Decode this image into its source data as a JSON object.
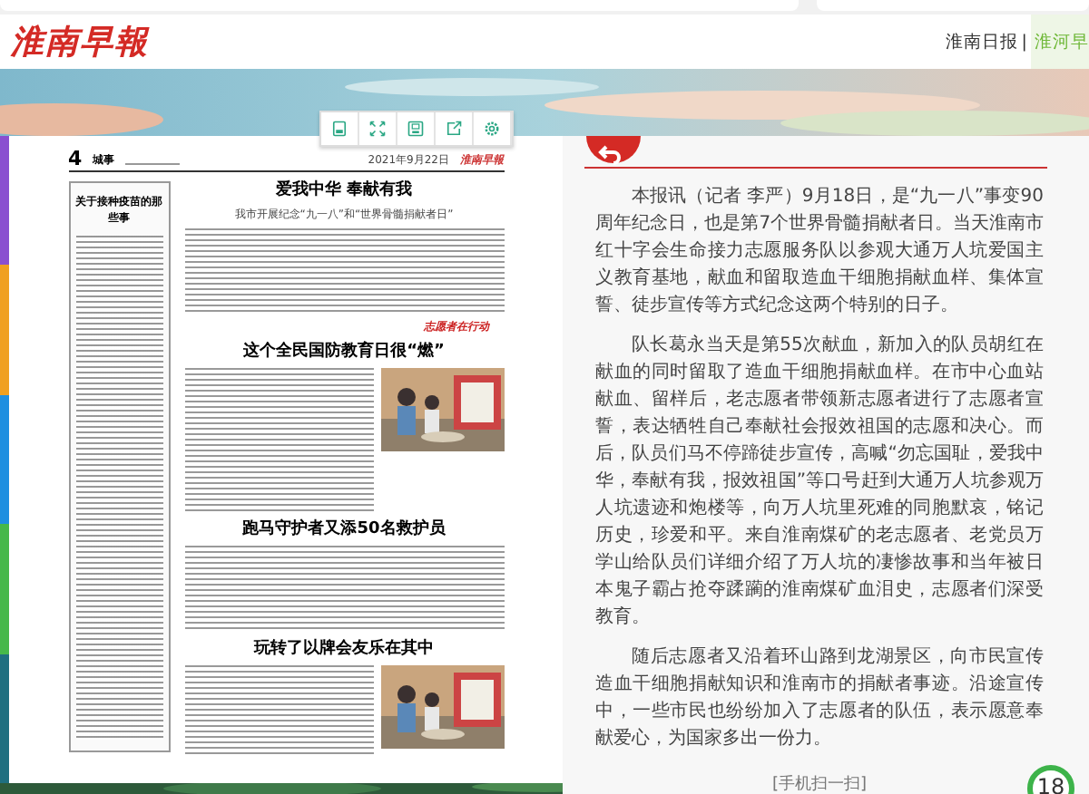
{
  "header": {
    "logo": "淮南早報",
    "links": [
      {
        "label": "淮南日报",
        "selected": false
      },
      {
        "label": "淮河早",
        "selected": true
      }
    ],
    "separator": "|"
  },
  "toolbar": {
    "buttons": [
      {
        "kind": "page"
      },
      {
        "kind": "fullscreen"
      },
      {
        "kind": "save"
      },
      {
        "kind": "share"
      },
      {
        "kind": "settings"
      }
    ]
  },
  "newspaper": {
    "page_number": "4",
    "section": "城事",
    "date": "2021年9月22日",
    "masthead": "淮南早報",
    "side_article": {
      "headline": "关于接种疫苗的那些事"
    },
    "articles": [
      {
        "kind": "text",
        "headline": "爱我中华  奉献有我",
        "subheadline": "我市开展纪念“九一八”和“世界骨髓捐献者日”",
        "stamp": "志愿者在行动"
      },
      {
        "headline": "这个全民国防教育日很“燃”"
      },
      {
        "kind": "text",
        "headline": "跑马守护者又添50名救护员"
      },
      {
        "headline": "玩转了以牌会友乐在其中"
      }
    ]
  },
  "article": {
    "paragraphs": [
      "本报讯（记者 李严）9月18日，是“九一八”事变90周年纪念日，也是第7个世界骨髓捐献者日。当天淮南市红十字会生命接力志愿服务队以参观大通万人坑爱国主义教育基地，献血和留取造血干细胞捐献血样、集体宣誓、徒步宣传等方式纪念这两个特别的日子。",
      "队长葛永当天是第55次献血，新加入的队员胡红在献血的同时留取了造血干细胞捐献血样。在市中心血站献血、留样后，老志愿者带领新志愿者进行了志愿者宣誓，表达牺牲自己奉献社会报效祖国的志愿和决心。而后，队员们马不停蹄徒步宣传，高喊“勿忘国耻，爱我中华，奉献有我，报效祖国”等口号赶到大通万人坑参观万人坑遗迹和炮楼等，向万人坑里死难的同胞默哀，铭记历史，珍爱和平。来自淮南煤矿的老志愿者、老党员万学山给队员们详细介绍了万人坑的凄惨故事和当年被日本鬼子霸占抢夺蹂躏的淮南煤矿血泪史，志愿者们深受教育。",
      "随后志愿者又沿着环山路到龙湖景区，向市民宣传造血干细胞捐献知识和淮南市的捐献者事迹。沿途宣传中，一些市民也纷纷加入了志愿者的队伍，表示愿意奉献爱心，为国家多出一份力。"
    ],
    "footer": "[手机扫一扫]"
  },
  "page_badge": "18"
}
